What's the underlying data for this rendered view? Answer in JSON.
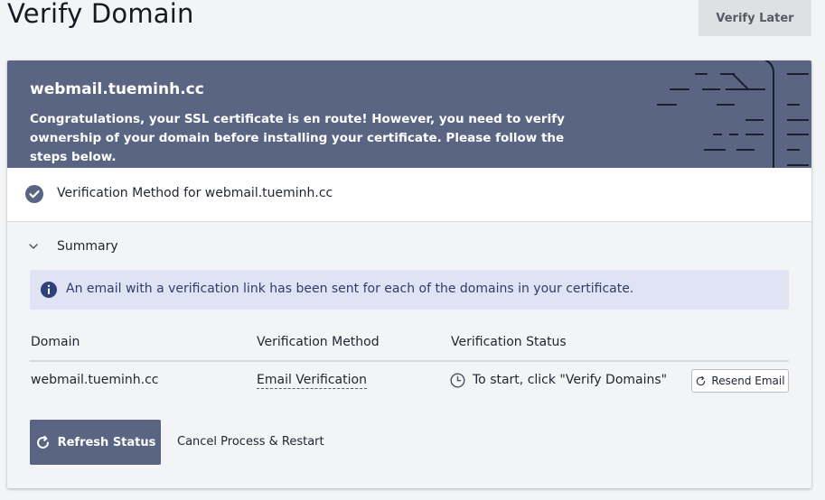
{
  "page": {
    "title": "Verify Domain",
    "verify_later_label": "Verify Later"
  },
  "banner": {
    "domain": "webmail.tueminh.cc",
    "message": "Congratulations, your SSL certificate is en route! However, you need to verify ownership of your domain before installing your certificate. Please follow the steps below."
  },
  "method_section": {
    "label": "Verification Method for webmail.tueminh.cc",
    "icon": "check-circle-icon"
  },
  "summary": {
    "label": "Summary",
    "icon": "chevron-down-icon",
    "info_message": "An email with a verification link has been sent for each of the domains in your certificate.",
    "info_icon": "info-icon"
  },
  "table": {
    "headers": [
      "Domain",
      "Verification Method",
      "Verification Status"
    ],
    "rows": [
      {
        "domain": "webmail.tueminh.cc",
        "method": "Email Verification",
        "status": "To start, click \"Verify Domains\"",
        "status_icon": "clock-icon",
        "resend_label": "Resend Email"
      }
    ]
  },
  "actions": {
    "refresh_label": "Refresh Status",
    "cancel_label": "Cancel Process & Restart"
  },
  "colors": {
    "accent": "#5a6583",
    "info_bg": "#dfe3f4",
    "info_text": "#2d3d6b",
    "page_bg": "#f3f4f6"
  }
}
